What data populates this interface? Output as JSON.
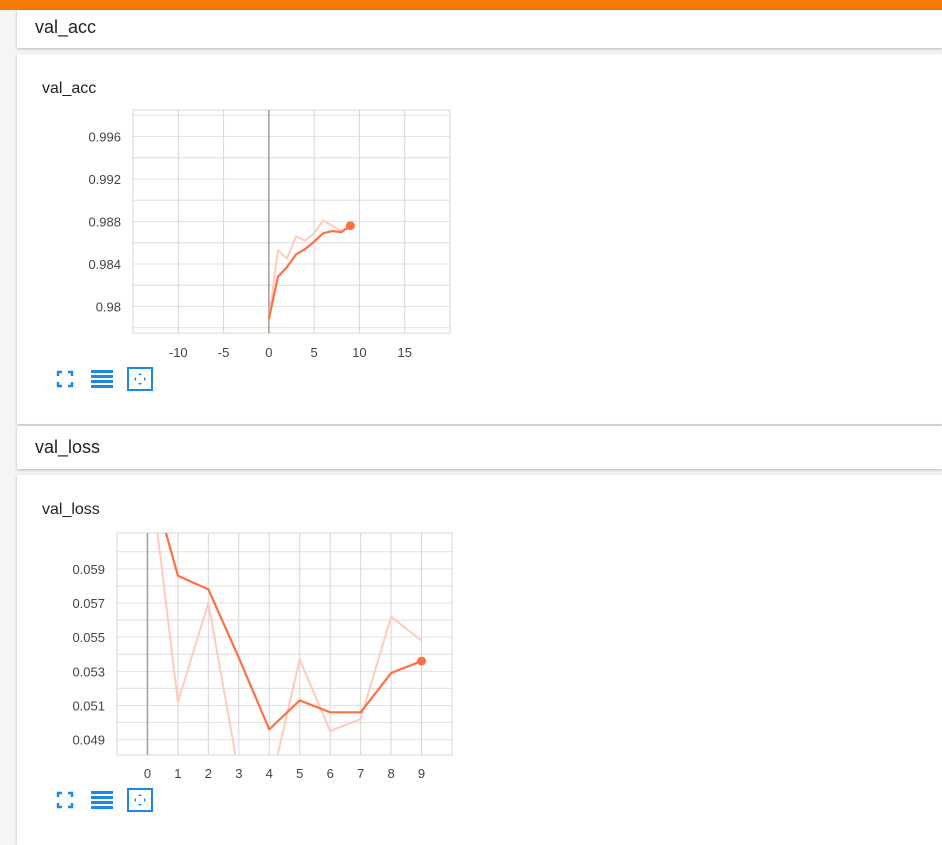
{
  "colors": {
    "accent_bar": "#f57c00",
    "line_smoothed": "#ff7043",
    "line_raw": "#ffccbc",
    "grid": "#d7d7d7",
    "zero_axis": "#9e9e9e",
    "icon": "#1e88e5"
  },
  "sections": [
    {
      "header": "val_acc",
      "card_title": "val_acc"
    },
    {
      "header": "val_loss",
      "card_title": "val_loss"
    }
  ],
  "icons": [
    "fit-domain-icon",
    "toggle-log-scale-icon",
    "expand-chart-icon"
  ],
  "chart_data": [
    {
      "type": "line",
      "title": "val_acc",
      "xlabel": "",
      "ylabel": "",
      "xlim": [
        -15,
        20
      ],
      "ylim": [
        0.9775,
        0.9985
      ],
      "xticks": [
        -10,
        -5,
        0,
        5,
        10,
        15
      ],
      "xtick_labels": [
        "-10",
        "-5",
        "0",
        "5",
        "10",
        "15"
      ],
      "yticks": [
        0.98,
        0.984,
        0.988,
        0.992,
        0.996
      ],
      "ytick_labels": [
        "0.98",
        "0.984",
        "0.988",
        "0.992",
        "0.996"
      ],
      "grid": true,
      "series": [
        {
          "role": "raw",
          "x": [
            0,
            1,
            2,
            3,
            4,
            5,
            6,
            7,
            8,
            9
          ],
          "values": [
            0.9788,
            0.9853,
            0.9845,
            0.9866,
            0.9862,
            0.9869,
            0.9881,
            0.9876,
            0.9871,
            0.9876
          ]
        },
        {
          "role": "smoothed",
          "x": [
            0,
            1,
            2,
            3,
            4,
            5,
            6,
            7,
            8,
            9
          ],
          "values": [
            0.9788,
            0.9828,
            0.9837,
            0.9849,
            0.9854,
            0.9861,
            0.9869,
            0.9871,
            0.987,
            0.9876
          ]
        }
      ]
    },
    {
      "type": "line",
      "title": "val_loss",
      "xlabel": "",
      "ylabel": "",
      "xlim": [
        -1,
        10
      ],
      "ylim": [
        0.0481,
        0.0611
      ],
      "xticks": [
        0,
        1,
        2,
        3,
        4,
        5,
        6,
        7,
        8,
        9
      ],
      "xtick_labels": [
        "0",
        "1",
        "2",
        "3",
        "4",
        "5",
        "6",
        "7",
        "8",
        "9"
      ],
      "yticks": [
        0.049,
        0.051,
        0.053,
        0.055,
        0.057,
        0.059
      ],
      "ytick_labels": [
        "0.049",
        "0.051",
        "0.053",
        "0.055",
        "0.057",
        "0.059"
      ],
      "grid": true,
      "series": [
        {
          "role": "raw",
          "x": [
            0,
            1,
            2,
            3,
            4,
            5,
            6,
            7,
            8,
            9
          ],
          "values": [
            0.066,
            0.0512,
            0.057,
            0.047,
            0.046,
            0.0537,
            0.0495,
            0.0502,
            0.0562,
            0.0548
          ]
        },
        {
          "role": "smoothed",
          "x": [
            0,
            1,
            2,
            3,
            4,
            5,
            6,
            7,
            8,
            9
          ],
          "values": [
            0.065,
            0.0586,
            0.0578,
            0.0538,
            0.0496,
            0.0513,
            0.0506,
            0.0506,
            0.0529,
            0.0536
          ]
        }
      ]
    }
  ]
}
